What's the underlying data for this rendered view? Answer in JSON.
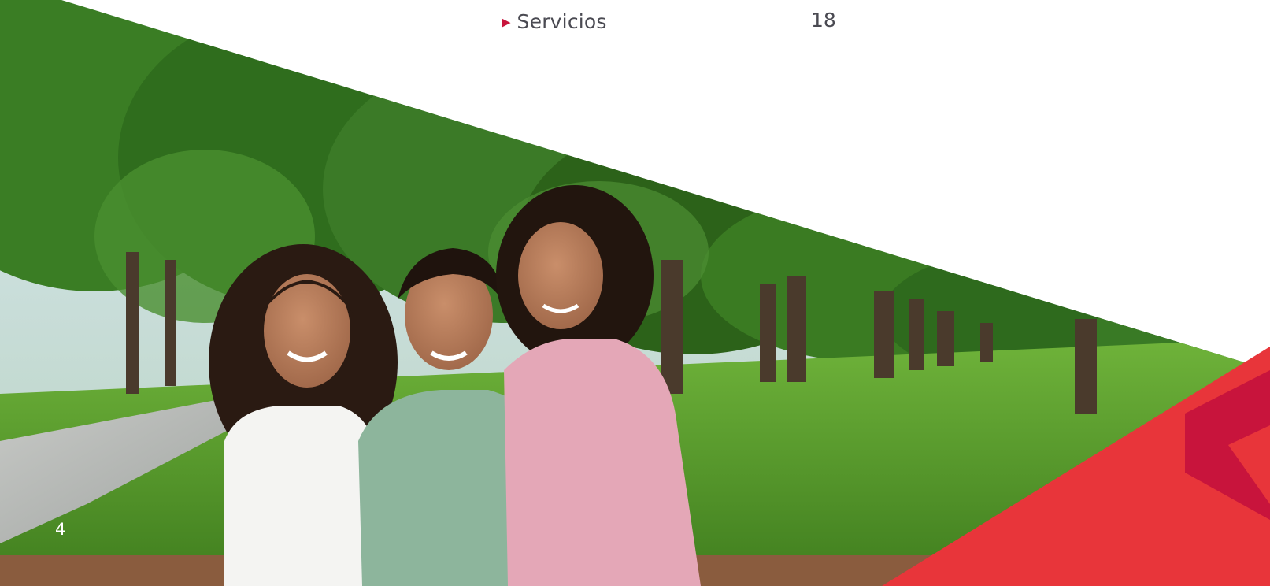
{
  "toc": {
    "label": "Servicios",
    "page": "18",
    "bullet_color": "#c8143c"
  },
  "footer": {
    "page_number": "4"
  },
  "colors": {
    "accent_red": "#e8353a",
    "accent_dark_red": "#c8143c",
    "text_gray": "#4a4a52",
    "grass_green": "#5f9f2a",
    "foliage_green": "#2f6d1d"
  },
  "photo": {
    "subject": "three smiling children sitting in a park"
  }
}
